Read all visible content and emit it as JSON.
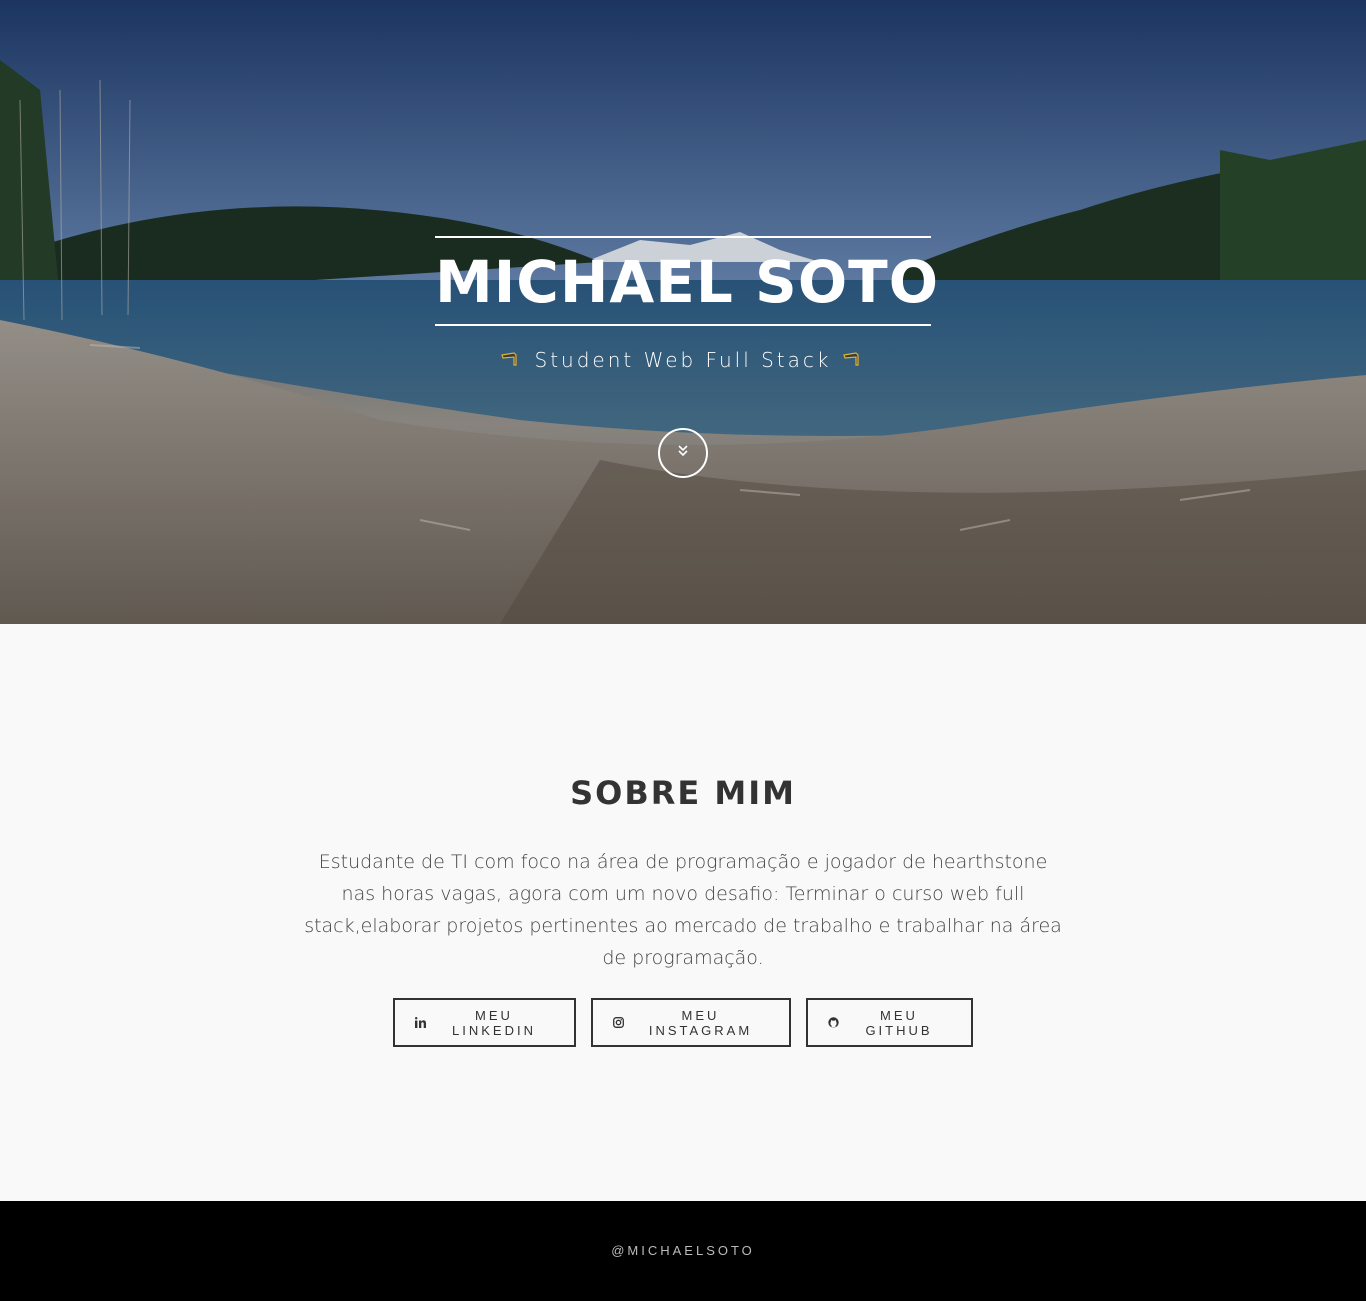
{
  "hero": {
    "title": "MICHAEL SOTO",
    "subtitle": "Student Web Full Stack",
    "left_icon": "pointing-hand-right-icon",
    "right_icon": "pointing-hand-left-icon",
    "scroll_icon": "double-chevron-down-icon",
    "accent_color": "#e0b630"
  },
  "about": {
    "heading": "SOBRE MIM",
    "text": "Estudante de TI com foco na área de programação e jogador de hearthstone nas horas vagas, agora com um novo desafio: Terminar o curso web full stack,elaborar projetos pertinentes ao mercado de trabalho e trabalhar na área de programação.",
    "buttons": [
      {
        "label": "MEU LINKEDIN",
        "icon": "linkedin-icon"
      },
      {
        "label": "MEU INSTAGRAM",
        "icon": "instagram-icon"
      },
      {
        "label": "MEU GITHUB",
        "icon": "github-icon"
      }
    ]
  },
  "footer": {
    "text": "@MICHAELSOTO"
  }
}
